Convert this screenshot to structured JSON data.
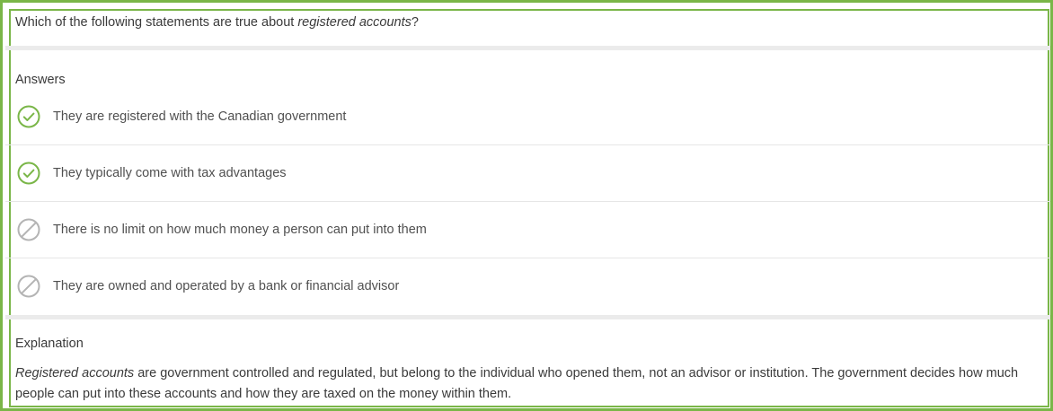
{
  "question": {
    "prefix": "Which of the following statements are true about ",
    "emphasis": "registered accounts",
    "suffix": "?"
  },
  "answers_section": {
    "title": "Answers",
    "items": [
      {
        "text": "They are registered with the Canadian government",
        "status": "correct",
        "icon": "check-circle-icon"
      },
      {
        "text": "They typically come with tax advantages",
        "status": "correct",
        "icon": "check-circle-icon"
      },
      {
        "text": "There is no limit on how much money a person can put into them",
        "status": "incorrect",
        "icon": "prohibited-icon"
      },
      {
        "text": "They are owned and operated by a bank or financial advisor",
        "status": "incorrect",
        "icon": "prohibited-icon"
      }
    ]
  },
  "explanation": {
    "title": "Explanation",
    "emphasis": "Registered accounts",
    "body": " are government controlled and regulated, but belong to the individual who opened them, not an advisor or institution. The government decides how much people can put into these accounts and how they are taxed on the money within them."
  },
  "colors": {
    "accent_green": "#7ab648",
    "neutral_icon": "#b4b4b4",
    "separator": "#ebebeb"
  }
}
